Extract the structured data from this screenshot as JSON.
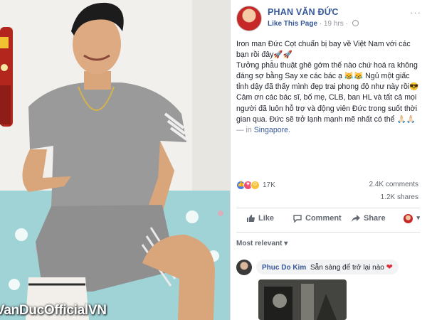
{
  "photo": {
    "watermark": "VanDucOfficialVN"
  },
  "post": {
    "page_name": "PHAN VĂN ĐỨC",
    "like_page": "Like This Page",
    "time": "· 19 hrs ·",
    "more": "···",
    "body_lines": [
      "Iron man Đức Cọt chuẩn bị bay về Việt Nam với các bạn rồi đây🚀🚀",
      "Tưởng phẫu thuật ghê gớm thế nào chứ hoá ra không đáng sợ bằng Say xe các bác ạ 😹😹 Ngủ một giấc tỉnh dậy đã thấy mình đẹp trai phong độ như này rồi😎",
      "Cảm ơn các bác sĩ, bố mẹ, CLB, ban HL và tất cả mọi người đã luôn hỗ trợ và động viên Đức trong suốt thời gian qua. Đức sẽ trở lạnh mạnh mẽ nhất có thể 🙏🏻🙏🏻"
    ],
    "location_prefix": " — in ",
    "location": "Singapore.",
    "reactions": {
      "count": "17K",
      "comments": "2.4K comments",
      "shares": "1.2K shares"
    },
    "actions": {
      "like": "Like",
      "comment": "Comment",
      "share": "Share"
    },
    "sort_label": "Most relevant ▾",
    "comment": {
      "author": "Phuc Do Kim",
      "text": "Sẵn sàng để trở lại nào",
      "heart": "❤"
    }
  }
}
